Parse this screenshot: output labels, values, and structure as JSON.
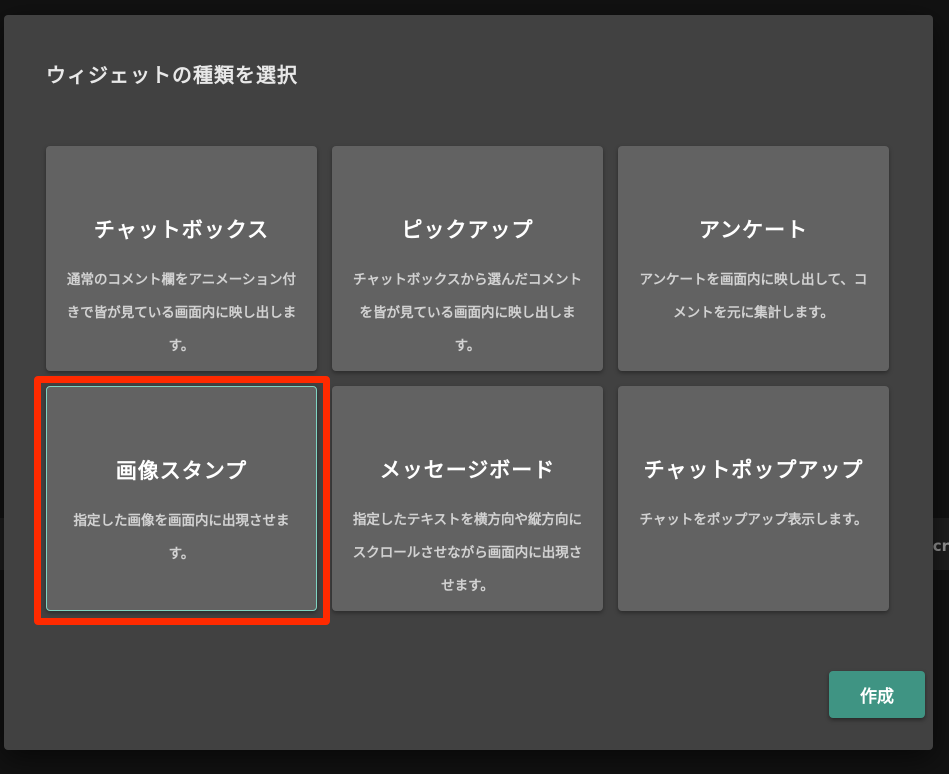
{
  "background": {
    "partial_text": "cr"
  },
  "modal": {
    "title": "ウィジェットの種類を選択",
    "create_label": "作成"
  },
  "cards": [
    {
      "title": "チャットボックス",
      "desc_lines": [
        "通常のコメント欄をアニメーション付",
        "きで皆が見ている画面内に映し出しま",
        "す。"
      ]
    },
    {
      "title": "ピックアップ",
      "desc_lines": [
        "チャットボックスから選んだコメント",
        "を皆が見ている画面内に映し出しま",
        "す。"
      ]
    },
    {
      "title": "アンケート",
      "desc_lines": [
        "アンケートを画面内に映し出して、コ",
        "メントを元に集計します。"
      ]
    },
    {
      "title": "画像スタンプ",
      "desc_lines": [
        "指定した画像を画面内に出現させま",
        "す。"
      ],
      "selected": true
    },
    {
      "title": "メッセージボード",
      "desc_lines": [
        "指定したテキストを横方向や縦方向に",
        "スクロールさせながら画面内に出現さ",
        "せます。"
      ]
    },
    {
      "title": "チャットポップアップ",
      "desc_lines": [
        "チャットをポップアップ表示します。"
      ]
    }
  ],
  "colors": {
    "accent": "#3f9483",
    "selected_border": "#7fd3c2",
    "highlight_annotation": "#ff2a00"
  }
}
